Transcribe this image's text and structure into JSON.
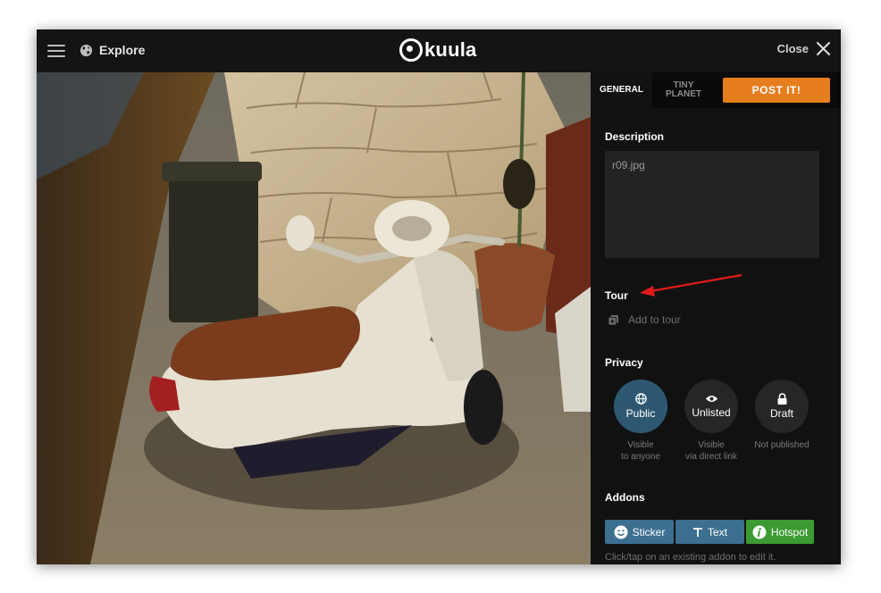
{
  "header": {
    "explore_label": "Explore",
    "logo_text": "kuula",
    "close_label": "Close",
    "icons": {
      "menu": "hamburger-icon",
      "explore": "globe-icon",
      "close": "close-icon"
    }
  },
  "tabs": {
    "general_label": "GENERAL",
    "tiny_planet_label": "TINY\nPLANET",
    "post_label": "POST IT!"
  },
  "description": {
    "label": "Description",
    "value": "r09.jpg"
  },
  "tour": {
    "label": "Tour",
    "add_label": "Add to tour"
  },
  "privacy": {
    "label": "Privacy",
    "options": [
      {
        "label": "Public",
        "sub": "Visible\nto anyone",
        "icon": "globe-icon",
        "selected": true
      },
      {
        "label": "Unlisted",
        "sub": "Visible\nvia direct link",
        "icon": "eye-icon",
        "selected": false
      },
      {
        "label": "Draft",
        "sub": "Not published",
        "icon": "lock-icon",
        "selected": false
      }
    ]
  },
  "addons": {
    "label": "Addons",
    "buttons": [
      {
        "label": "Sticker",
        "icon": "smiley-icon"
      },
      {
        "label": "Text",
        "icon": "text-icon"
      },
      {
        "label": "Hotspot",
        "icon": "info-icon"
      }
    ],
    "hint": "Click/tap on an existing addon to edit it."
  },
  "colors": {
    "post_button": "#e67e1e",
    "public_selected": "#2e5872",
    "addon_blue": "#3d6f91",
    "addon_green": "#3c9a32",
    "annotation_arrow": "#e01b1b"
  }
}
